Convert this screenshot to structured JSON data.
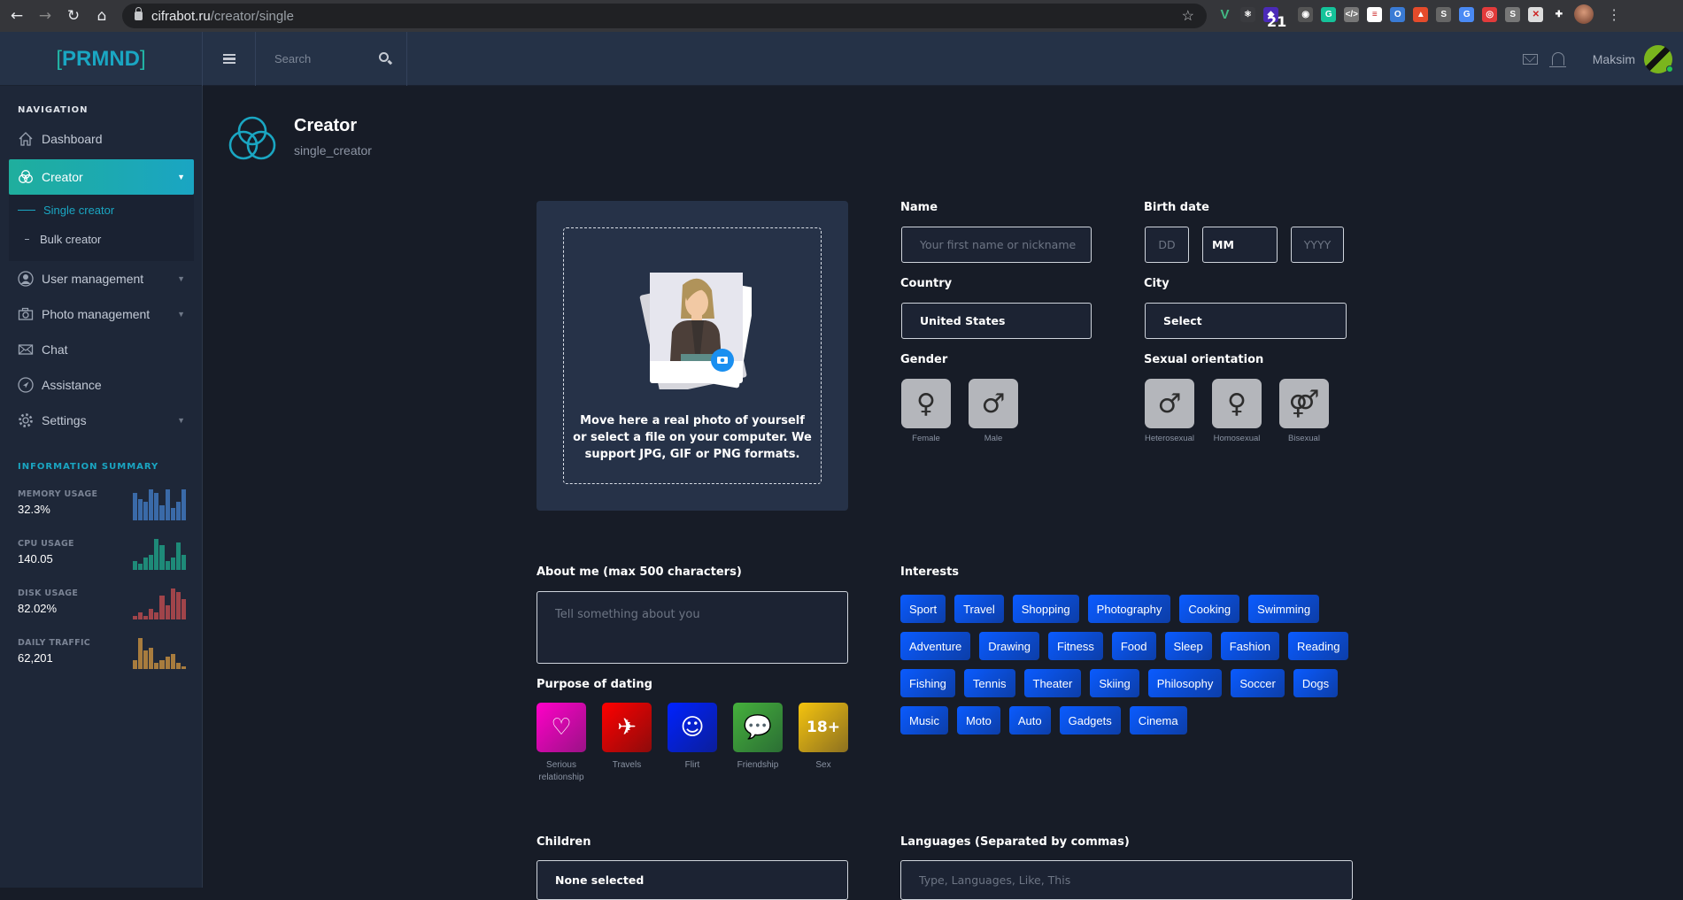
{
  "browser": {
    "url_host": "cifrabot.ru",
    "url_path": "/creator/single",
    "extension_badge": "21",
    "extensions": [
      {
        "name": "vue-devtools-icon",
        "color": "#42b883",
        "glyph": "V"
      },
      {
        "name": "react-devtools-icon",
        "color": "#3a3b3f",
        "glyph": "⚛"
      },
      {
        "name": "stack-extension-icon",
        "color": "#4b2ab8",
        "glyph": "◆"
      },
      {
        "name": "camera-extension-icon",
        "color": "#555",
        "glyph": "◉"
      },
      {
        "name": "grammarly-icon",
        "color": "#15c39a",
        "glyph": "G"
      },
      {
        "name": "code-extension-icon",
        "color": "#777",
        "glyph": "</>"
      },
      {
        "name": "list-extension-icon",
        "color": "#fff",
        "glyph": "≡"
      },
      {
        "name": "ring-extension-icon",
        "color": "#3a7bd5",
        "glyph": "O"
      },
      {
        "name": "android-extension-icon",
        "color": "#e54b2b",
        "glyph": "▲"
      },
      {
        "name": "s-extension-icon",
        "color": "#666",
        "glyph": "S"
      },
      {
        "name": "translate-extension-icon",
        "color": "#4a8af4",
        "glyph": "G"
      },
      {
        "name": "target-extension-icon",
        "color": "#e23b3b",
        "glyph": "◎"
      },
      {
        "name": "shopify-extension-icon",
        "color": "#777",
        "glyph": "S"
      },
      {
        "name": "shield-extension-icon",
        "color": "#ddd",
        "glyph": "✕"
      },
      {
        "name": "puzzle-extensions-icon",
        "color": "#35363a",
        "glyph": "✚"
      }
    ]
  },
  "header": {
    "logo": "PRMND",
    "search_placeholder": "Search",
    "username": "Maksim"
  },
  "sidebar": {
    "nav_title": "NAVIGATION",
    "items": [
      {
        "label": "Dashboard",
        "icon": "home-icon"
      },
      {
        "label": "Creator",
        "icon": "circles-icon",
        "active": true
      },
      {
        "label": "User management",
        "icon": "user-icon"
      },
      {
        "label": "Photo management",
        "icon": "camera-icon"
      },
      {
        "label": "Chat",
        "icon": "mail-icon"
      },
      {
        "label": "Assistance",
        "icon": "compass-icon"
      },
      {
        "label": "Settings",
        "icon": "gear-icon"
      }
    ],
    "submenu": [
      {
        "label": "Single creator",
        "active": true
      },
      {
        "label": "Bulk creator"
      }
    ],
    "info_title": "INFORMATION SUMMARY",
    "stats": [
      {
        "label": "MEMORY USAGE",
        "value": "32.3%",
        "color": "#3a6aa8",
        "bars": [
          9,
          7,
          6,
          10,
          9,
          5,
          10,
          4,
          6,
          10
        ]
      },
      {
        "label": "CPU USAGE",
        "value": "140.05",
        "color": "#1e8a78",
        "bars": [
          3,
          2,
          4,
          5,
          10,
          8,
          3,
          4,
          9,
          5
        ]
      },
      {
        "label": "DISK USAGE",
        "value": "82.02%",
        "color": "#a0444a",
        "bars": [
          1,
          2,
          1,
          3,
          2,
          7,
          4,
          9,
          8,
          6
        ]
      },
      {
        "label": "DAILY TRAFFIC",
        "value": "62,201",
        "color": "#a87c3e",
        "bars": [
          3,
          10,
          6,
          7,
          2,
          3,
          4,
          5,
          2,
          1
        ]
      }
    ]
  },
  "page": {
    "title": "Creator",
    "subtitle": "single_creator"
  },
  "upload": {
    "text": "Move here a real photo of yourself or select a file on your computer. We support JPG, GIF or PNG formats."
  },
  "form": {
    "name_label": "Name",
    "name_placeholder": "Your first name or nickname",
    "birth_label": "Birth date",
    "day_placeholder": "DD",
    "month_value": "MM",
    "year_placeholder": "YYYY",
    "country_label": "Country",
    "country_value": "United States",
    "city_label": "City",
    "city_value": "Select",
    "gender_label": "Gender",
    "genders": [
      {
        "label": "Female",
        "glyph": "♀"
      },
      {
        "label": "Male",
        "glyph": "♂"
      }
    ],
    "orientation_label": "Sexual orientation",
    "orientations": [
      {
        "label": "Heterosexual",
        "glyph": "♂"
      },
      {
        "label": "Homosexual",
        "glyph": "♀"
      },
      {
        "label": "Bisexual",
        "glyph": "⚤"
      }
    ],
    "about_label": "About me (max 500 characters)",
    "about_placeholder": "Tell something about you",
    "purpose_label": "Purpose of dating",
    "purposes": [
      {
        "label": "Serious relationship",
        "glyph": "♡",
        "from": "#ff00c8",
        "to": "#9a1286"
      },
      {
        "label": "Travels",
        "glyph": "✈",
        "from": "#ff0000",
        "to": "#8d0b0b"
      },
      {
        "label": "Flirt",
        "glyph": "☺",
        "from": "#0022ff",
        "to": "#0b1e9a"
      },
      {
        "label": "Friendship",
        "glyph": "💬",
        "from": "#45b03c",
        "to": "#2b6e34"
      },
      {
        "label": "Sex",
        "glyph": "18+",
        "from": "#f5c40e",
        "to": "#8c7020"
      }
    ],
    "interests_label": "Interests",
    "interests": [
      "Sport",
      "Travel",
      "Shopping",
      "Photography",
      "Cooking",
      "Swimming",
      "Adventure",
      "Drawing",
      "Fitness",
      "Food",
      "Sleep",
      "Fashion",
      "Reading",
      "Fishing",
      "Tennis",
      "Theater",
      "Skiing",
      "Philosophy",
      "Soccer",
      "Dogs",
      "Music",
      "Moto",
      "Auto",
      "Gadgets",
      "Cinema"
    ],
    "children_label": "Children",
    "children_value": "None selected",
    "languages_label": "Languages (Separated by commas)",
    "languages_placeholder": "Type, Languages, Like, This"
  }
}
